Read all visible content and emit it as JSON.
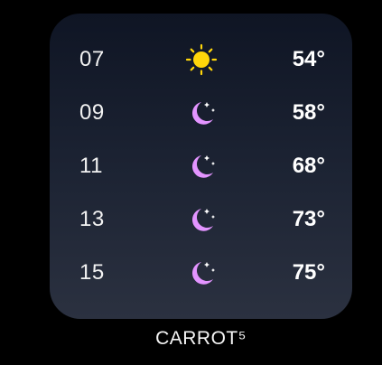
{
  "forecast": [
    {
      "hour": "07",
      "icon": "sun-icon",
      "temp": "54°"
    },
    {
      "hour": "09",
      "icon": "moon-stars-icon",
      "temp": "58°"
    },
    {
      "hour": "11",
      "icon": "moon-stars-icon",
      "temp": "68°"
    },
    {
      "hour": "13",
      "icon": "moon-stars-icon",
      "temp": "73°"
    },
    {
      "hour": "15",
      "icon": "moon-stars-icon",
      "temp": "75°"
    }
  ],
  "caption": "CARROT⁵",
  "colors": {
    "sun": "#ffd60a",
    "moon": "#e394ff",
    "background": "#000000"
  }
}
